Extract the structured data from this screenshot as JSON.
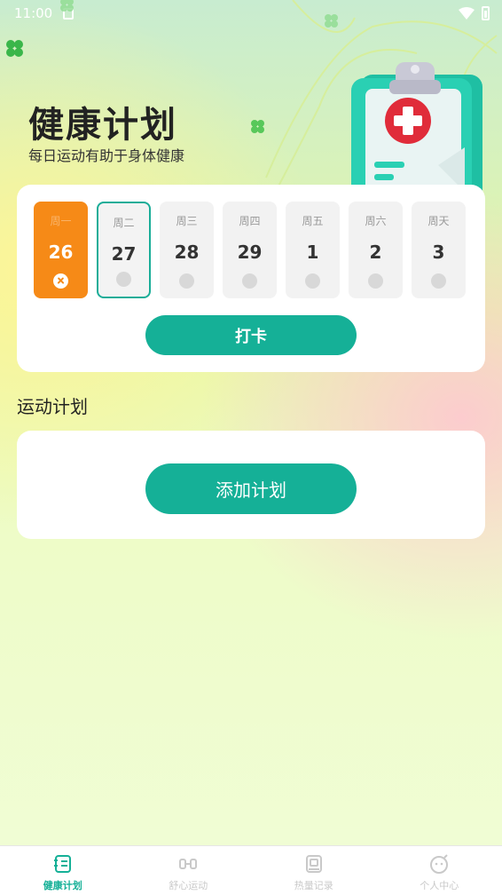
{
  "status_bar": {
    "time": "11:00"
  },
  "header": {
    "title": "健康计划",
    "subtitle": "每日运动有助于身体健康"
  },
  "week": {
    "days": [
      {
        "weekday": "周一",
        "date": "26",
        "state": "current"
      },
      {
        "weekday": "周二",
        "date": "27",
        "state": "selected"
      },
      {
        "weekday": "周三",
        "date": "28",
        "state": "default"
      },
      {
        "weekday": "周四",
        "date": "29",
        "state": "default"
      },
      {
        "weekday": "周五",
        "date": "1",
        "state": "default"
      },
      {
        "weekday": "周六",
        "date": "2",
        "state": "default"
      },
      {
        "weekday": "周天",
        "date": "3",
        "state": "default"
      }
    ],
    "checkin_label": "打卡"
  },
  "plan": {
    "section_title": "运动计划",
    "add_label": "添加计划"
  },
  "nav": {
    "items": [
      {
        "label": "健康计划",
        "icon": "health-plan-icon",
        "active": true
      },
      {
        "label": "舒心运动",
        "icon": "dumbbell-icon",
        "active": false
      },
      {
        "label": "热量记录",
        "icon": "calorie-book-icon",
        "active": false
      },
      {
        "label": "个人中心",
        "icon": "profile-smile-icon",
        "active": false
      }
    ]
  },
  "colors": {
    "accent": "#15b097",
    "current_day": "#f68a17",
    "background_top": "#c8ecd0",
    "background_bottom": "#f0fdd6"
  }
}
